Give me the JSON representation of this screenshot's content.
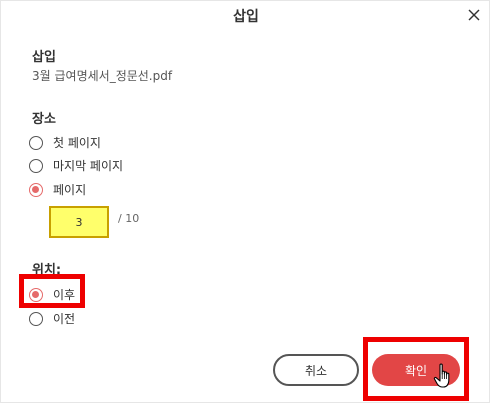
{
  "dialog": {
    "title": "삽입",
    "close_icon": "close-icon"
  },
  "insert_section": {
    "heading": "삽입",
    "file_name": "3월 급여명세서_정문선.pdf"
  },
  "location_section": {
    "heading": "장소",
    "options": [
      {
        "label": "첫 페이지",
        "checked": false
      },
      {
        "label": "마지막 페이지",
        "checked": false
      },
      {
        "label": "페이지",
        "checked": true
      }
    ],
    "page_input_value": "3",
    "page_total": "/ 10"
  },
  "position_section": {
    "heading": "위치:",
    "options": [
      {
        "label": "이후",
        "checked": true
      },
      {
        "label": "이전",
        "checked": false
      }
    ]
  },
  "buttons": {
    "cancel_label": "취소",
    "ok_label": "확인"
  },
  "colors": {
    "accent": "#e56a6a",
    "primary_button": "#e24646",
    "input_highlight": "#ffff6b",
    "annotation": "#ee0000"
  }
}
